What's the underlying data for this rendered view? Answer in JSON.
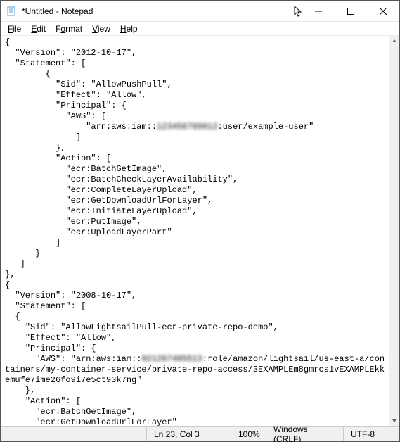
{
  "window": {
    "title": "*Untitled - Notepad"
  },
  "menu": {
    "file": "File",
    "edit": "Edit",
    "format": "Format",
    "view": "View",
    "help": "Help"
  },
  "editor": {
    "lines": [
      "{",
      "  \"Version\": \"2012-10-17\",",
      "  \"Statement\": [",
      "        {",
      "          \"Sid\": \"AllowPushPull\",",
      "          \"Effect\": \"Allow\",",
      "          \"Principal\": {",
      "            \"AWS\": [",
      "                \"arn:aws:iam::",
      ":user/example-user\"",
      "              ]",
      "          },",
      "          \"Action\": [",
      "            \"ecr:BatchGetImage\",",
      "            \"ecr:BatchCheckLayerAvailability\",",
      "            \"ecr:CompleteLayerUpload\",",
      "            \"ecr:GetDownloadUrlForLayer\",",
      "            \"ecr:InitiateLayerUpload\",",
      "            \"ecr:PutImage\",",
      "            \"ecr:UploadLayerPart\"",
      "          ]",
      "      }",
      "   ]",
      "},",
      "{",
      "  \"Version\": \"2008-10-17\",",
      "  \"Statement\": [",
      "  {",
      "    \"Sid\": \"AllowLightsailPull-ecr-private-repo-demo\",",
      "    \"Effect\": \"Allow\",",
      "    \"Principal\": {",
      "      \"AWS\": \"arn:aws:iam::",
      ":role/amazon/lightsail/us-east-a/containers/my-container-service/private-repo-access/3EXAMPLEm8gmrcs1vEXAMPLEkkemufe7ime26fo9i7e5ct93k7ng\"",
      "    },",
      "    \"Action\": [",
      "      \"ecr:BatchGetImage\",",
      "      \"ecr:GetDownloadUrlForLayer\"",
      "    ]",
      "  }",
      "  ]",
      "}"
    ],
    "redacted1": "123456789012",
    "redacted2": "021267485513"
  },
  "status": {
    "position": "Ln 23, Col 3",
    "zoom": "100%",
    "lineending": "Windows (CRLF)",
    "encoding": "UTF-8"
  }
}
